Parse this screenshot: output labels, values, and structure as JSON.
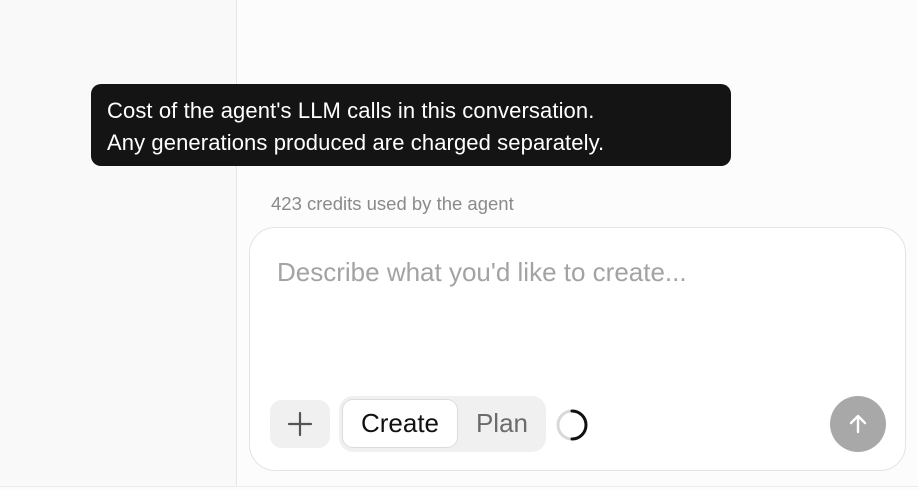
{
  "tooltip": {
    "line1": "Cost of the agent's LLM calls in this conversation.",
    "line2": "Any generations produced are charged separately."
  },
  "credits": {
    "label": "423 credits used by the agent"
  },
  "composer": {
    "placeholder": "Describe what you'd like to create...",
    "value": "",
    "add_icon": "plus-icon",
    "modes": [
      {
        "label": "Create",
        "selected": true
      },
      {
        "label": "Plan",
        "selected": false
      }
    ],
    "loading_icon": "spinner-icon",
    "send_icon": "arrow-up-icon"
  },
  "colors": {
    "tooltip_bg": "#141414",
    "send_button": "#a8a8a8",
    "muted_text": "#8a8a8a"
  }
}
